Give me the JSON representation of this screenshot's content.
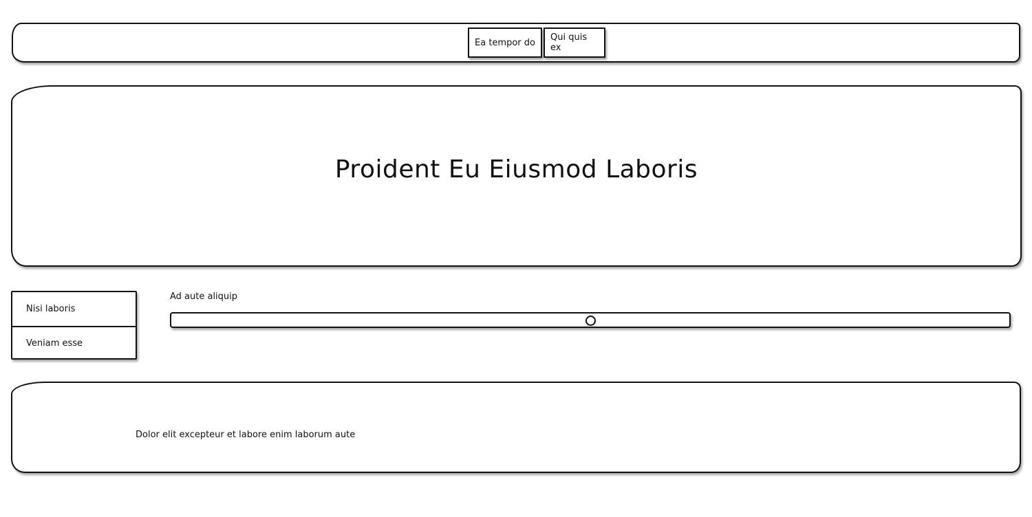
{
  "nav": {
    "buttons": [
      {
        "label": "Ea tempor do"
      },
      {
        "label": "Qui quis ex"
      }
    ]
  },
  "hero": {
    "title": "Proident Eu Eiusmod Laboris"
  },
  "side_menu": {
    "items": [
      {
        "label": "Nisi laboris"
      },
      {
        "label": "Veniam esse"
      }
    ]
  },
  "slider": {
    "label": "Ad aute aliquip",
    "value_fraction": 0.5
  },
  "footer": {
    "text": "Dolor elit excepteur et labore enim laborum aute"
  }
}
